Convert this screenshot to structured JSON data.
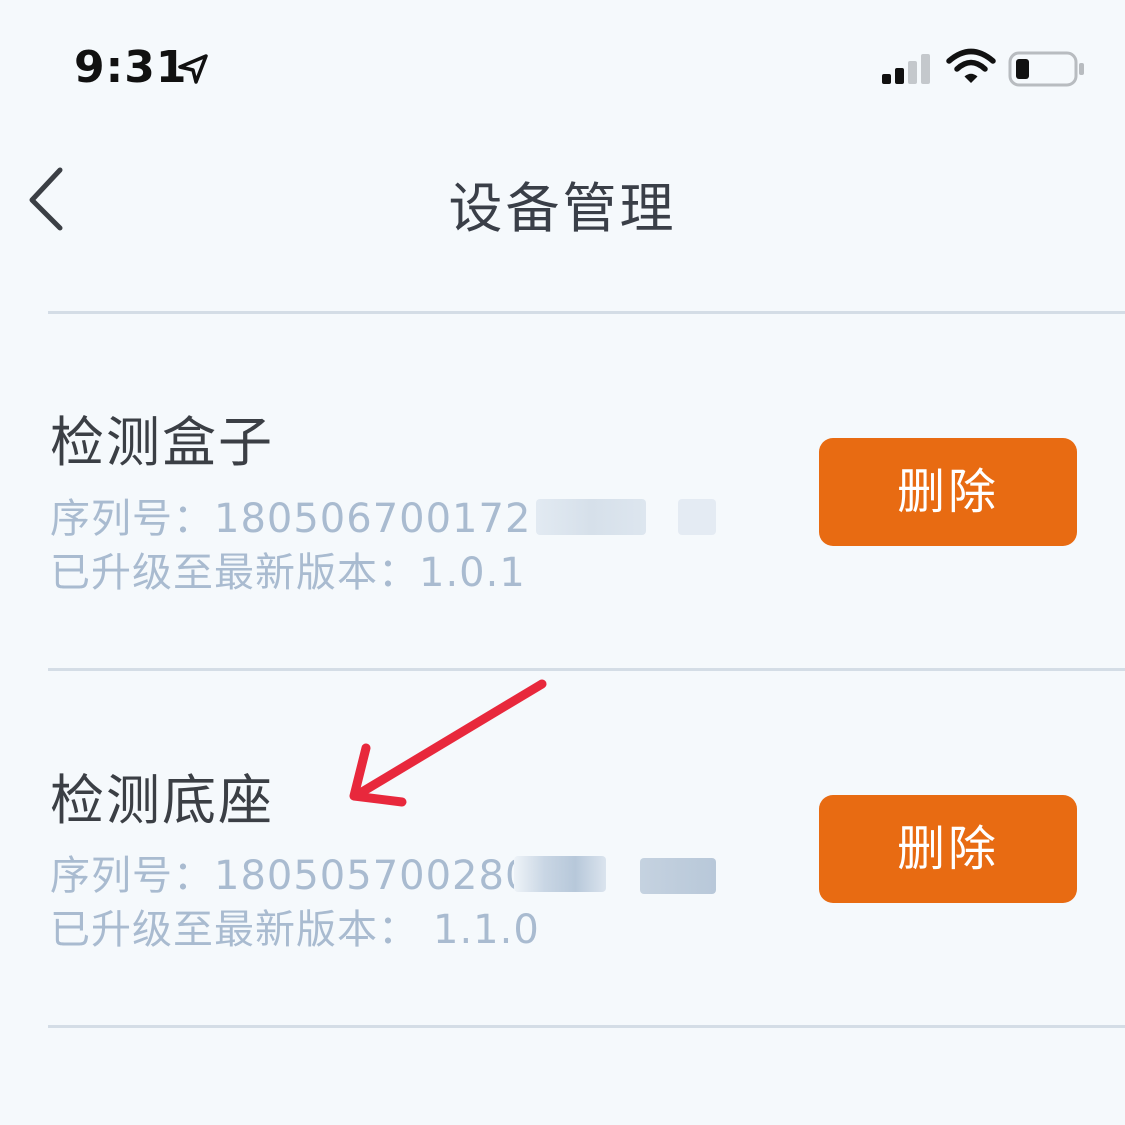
{
  "status_bar": {
    "time": "9:31",
    "icons": [
      "location-arrow-icon",
      "cellular-signal-icon",
      "wifi-icon",
      "battery-icon"
    ]
  },
  "nav": {
    "title": "设备管理",
    "back_icon": "chevron-left-icon"
  },
  "devices": [
    {
      "name": "检测盒子",
      "serial_label": "序列号：",
      "serial_value": "180506700172",
      "version_label": "已升级至最新版本：",
      "version_value": "1.0.1",
      "delete_label": "删除"
    },
    {
      "name": "检测底座",
      "serial_label": "序列号：",
      "serial_value": "180505700280",
      "version_label": "已升级至最新版本：",
      "version_value": "1.1.0",
      "delete_label": "删除"
    }
  ],
  "colors": {
    "background": "#f5f9fc",
    "accent": "#e86b12",
    "muted_text": "#a9bbd0",
    "annotation_arrow": "#e8283c"
  }
}
